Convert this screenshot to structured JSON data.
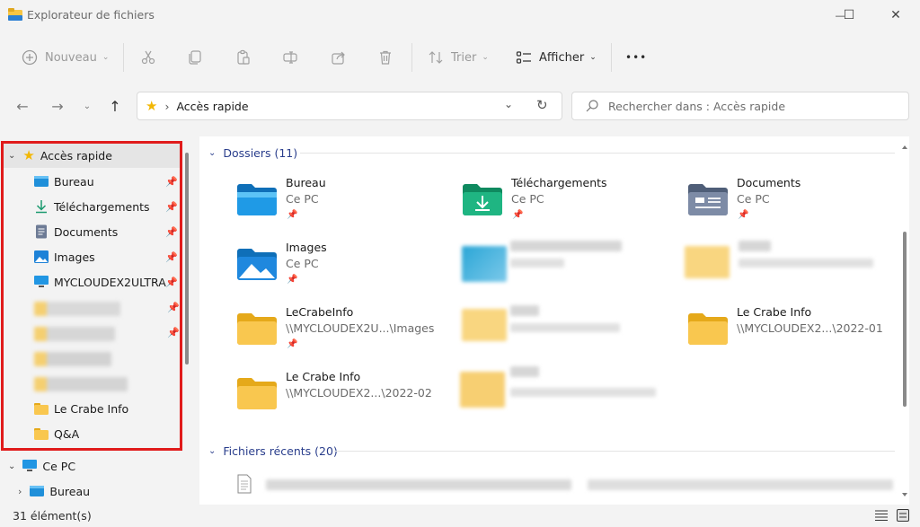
{
  "window": {
    "title": "Explorateur de fichiers",
    "minimize_glyph": "—",
    "maximize_glyph": "☐",
    "close_glyph": "✕"
  },
  "toolbar": {
    "new_label": "Nouveau",
    "sort_label": "Trier",
    "view_label": "Afficher",
    "more_label": "•••"
  },
  "address": {
    "separator": "›",
    "location": "Accès rapide"
  },
  "search": {
    "placeholder": "Rechercher dans : Accès rapide"
  },
  "sidebar": {
    "quick_access": "Accès rapide",
    "items": [
      {
        "label": "Bureau",
        "icon": "desktop-icon"
      },
      {
        "label": "Téléchargements",
        "icon": "download-icon"
      },
      {
        "label": "Documents",
        "icon": "document-icon"
      },
      {
        "label": "Images",
        "icon": "image-icon"
      },
      {
        "label": "MYCLOUDEX2ULTRA",
        "icon": "computer-icon"
      },
      {
        "label": "Le Crabe Info",
        "icon": "folder-icon"
      },
      {
        "label": "Q&A",
        "icon": "folder-icon"
      }
    ],
    "this_pc": "Ce PC",
    "this_pc_children": [
      {
        "label": "Bureau",
        "icon": "desktop-icon"
      }
    ]
  },
  "content": {
    "folders_header": "Dossiers (11)",
    "recent_header": "Fichiers récents (20)",
    "tiles": [
      {
        "name": "Bureau",
        "sub": "Ce PC",
        "icon": "desktop-folder-icon"
      },
      {
        "name": "Téléchargements",
        "sub": "Ce PC",
        "icon": "downloads-folder-icon"
      },
      {
        "name": "Documents",
        "sub": "Ce PC",
        "icon": "documents-folder-icon"
      },
      {
        "name": "Images",
        "sub": "Ce PC",
        "icon": "pictures-folder-icon"
      },
      {
        "name": "LeCrabeInfo",
        "sub": "\\\\MYCLOUDEX2U...\\Images",
        "icon": "folder-icon"
      },
      {
        "name": "Le Crabe Info",
        "sub": "\\\\MYCLOUDEX2...\\2022-01",
        "icon": "folder-icon"
      },
      {
        "name": "Le Crabe Info",
        "sub": "\\\\MYCLOUDEX2...\\2022-02",
        "icon": "folder-icon"
      }
    ]
  },
  "status": {
    "count": "31 élément(s)"
  },
  "colors": {
    "accent_red": "#e01b1b",
    "group_blue": "#2a3e8c",
    "folder_yellow": "#f9c74f"
  }
}
